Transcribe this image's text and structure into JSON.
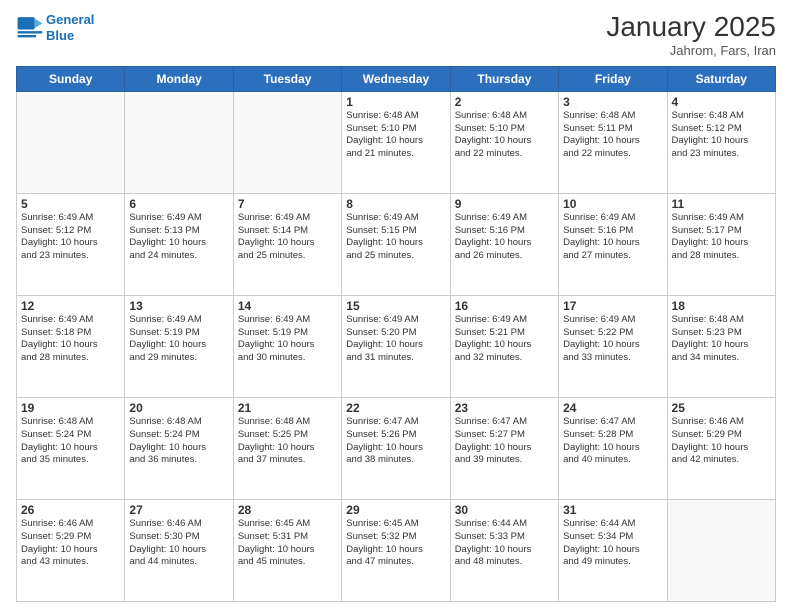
{
  "header": {
    "logo_line1": "General",
    "logo_line2": "Blue",
    "title": "January 2025",
    "location": "Jahrom, Fars, Iran"
  },
  "days_of_week": [
    "Sunday",
    "Monday",
    "Tuesday",
    "Wednesday",
    "Thursday",
    "Friday",
    "Saturday"
  ],
  "weeks": [
    [
      {
        "day": "",
        "info": ""
      },
      {
        "day": "",
        "info": ""
      },
      {
        "day": "",
        "info": ""
      },
      {
        "day": "1",
        "info": "Sunrise: 6:48 AM\nSunset: 5:10 PM\nDaylight: 10 hours\nand 21 minutes."
      },
      {
        "day": "2",
        "info": "Sunrise: 6:48 AM\nSunset: 5:10 PM\nDaylight: 10 hours\nand 22 minutes."
      },
      {
        "day": "3",
        "info": "Sunrise: 6:48 AM\nSunset: 5:11 PM\nDaylight: 10 hours\nand 22 minutes."
      },
      {
        "day": "4",
        "info": "Sunrise: 6:48 AM\nSunset: 5:12 PM\nDaylight: 10 hours\nand 23 minutes."
      }
    ],
    [
      {
        "day": "5",
        "info": "Sunrise: 6:49 AM\nSunset: 5:12 PM\nDaylight: 10 hours\nand 23 minutes."
      },
      {
        "day": "6",
        "info": "Sunrise: 6:49 AM\nSunset: 5:13 PM\nDaylight: 10 hours\nand 24 minutes."
      },
      {
        "day": "7",
        "info": "Sunrise: 6:49 AM\nSunset: 5:14 PM\nDaylight: 10 hours\nand 25 minutes."
      },
      {
        "day": "8",
        "info": "Sunrise: 6:49 AM\nSunset: 5:15 PM\nDaylight: 10 hours\nand 25 minutes."
      },
      {
        "day": "9",
        "info": "Sunrise: 6:49 AM\nSunset: 5:16 PM\nDaylight: 10 hours\nand 26 minutes."
      },
      {
        "day": "10",
        "info": "Sunrise: 6:49 AM\nSunset: 5:16 PM\nDaylight: 10 hours\nand 27 minutes."
      },
      {
        "day": "11",
        "info": "Sunrise: 6:49 AM\nSunset: 5:17 PM\nDaylight: 10 hours\nand 28 minutes."
      }
    ],
    [
      {
        "day": "12",
        "info": "Sunrise: 6:49 AM\nSunset: 5:18 PM\nDaylight: 10 hours\nand 28 minutes."
      },
      {
        "day": "13",
        "info": "Sunrise: 6:49 AM\nSunset: 5:19 PM\nDaylight: 10 hours\nand 29 minutes."
      },
      {
        "day": "14",
        "info": "Sunrise: 6:49 AM\nSunset: 5:19 PM\nDaylight: 10 hours\nand 30 minutes."
      },
      {
        "day": "15",
        "info": "Sunrise: 6:49 AM\nSunset: 5:20 PM\nDaylight: 10 hours\nand 31 minutes."
      },
      {
        "day": "16",
        "info": "Sunrise: 6:49 AM\nSunset: 5:21 PM\nDaylight: 10 hours\nand 32 minutes."
      },
      {
        "day": "17",
        "info": "Sunrise: 6:49 AM\nSunset: 5:22 PM\nDaylight: 10 hours\nand 33 minutes."
      },
      {
        "day": "18",
        "info": "Sunrise: 6:48 AM\nSunset: 5:23 PM\nDaylight: 10 hours\nand 34 minutes."
      }
    ],
    [
      {
        "day": "19",
        "info": "Sunrise: 6:48 AM\nSunset: 5:24 PM\nDaylight: 10 hours\nand 35 minutes."
      },
      {
        "day": "20",
        "info": "Sunrise: 6:48 AM\nSunset: 5:24 PM\nDaylight: 10 hours\nand 36 minutes."
      },
      {
        "day": "21",
        "info": "Sunrise: 6:48 AM\nSunset: 5:25 PM\nDaylight: 10 hours\nand 37 minutes."
      },
      {
        "day": "22",
        "info": "Sunrise: 6:47 AM\nSunset: 5:26 PM\nDaylight: 10 hours\nand 38 minutes."
      },
      {
        "day": "23",
        "info": "Sunrise: 6:47 AM\nSunset: 5:27 PM\nDaylight: 10 hours\nand 39 minutes."
      },
      {
        "day": "24",
        "info": "Sunrise: 6:47 AM\nSunset: 5:28 PM\nDaylight: 10 hours\nand 40 minutes."
      },
      {
        "day": "25",
        "info": "Sunrise: 6:46 AM\nSunset: 5:29 PM\nDaylight: 10 hours\nand 42 minutes."
      }
    ],
    [
      {
        "day": "26",
        "info": "Sunrise: 6:46 AM\nSunset: 5:29 PM\nDaylight: 10 hours\nand 43 minutes."
      },
      {
        "day": "27",
        "info": "Sunrise: 6:46 AM\nSunset: 5:30 PM\nDaylight: 10 hours\nand 44 minutes."
      },
      {
        "day": "28",
        "info": "Sunrise: 6:45 AM\nSunset: 5:31 PM\nDaylight: 10 hours\nand 45 minutes."
      },
      {
        "day": "29",
        "info": "Sunrise: 6:45 AM\nSunset: 5:32 PM\nDaylight: 10 hours\nand 47 minutes."
      },
      {
        "day": "30",
        "info": "Sunrise: 6:44 AM\nSunset: 5:33 PM\nDaylight: 10 hours\nand 48 minutes."
      },
      {
        "day": "31",
        "info": "Sunrise: 6:44 AM\nSunset: 5:34 PM\nDaylight: 10 hours\nand 49 minutes."
      },
      {
        "day": "",
        "info": ""
      }
    ]
  ]
}
